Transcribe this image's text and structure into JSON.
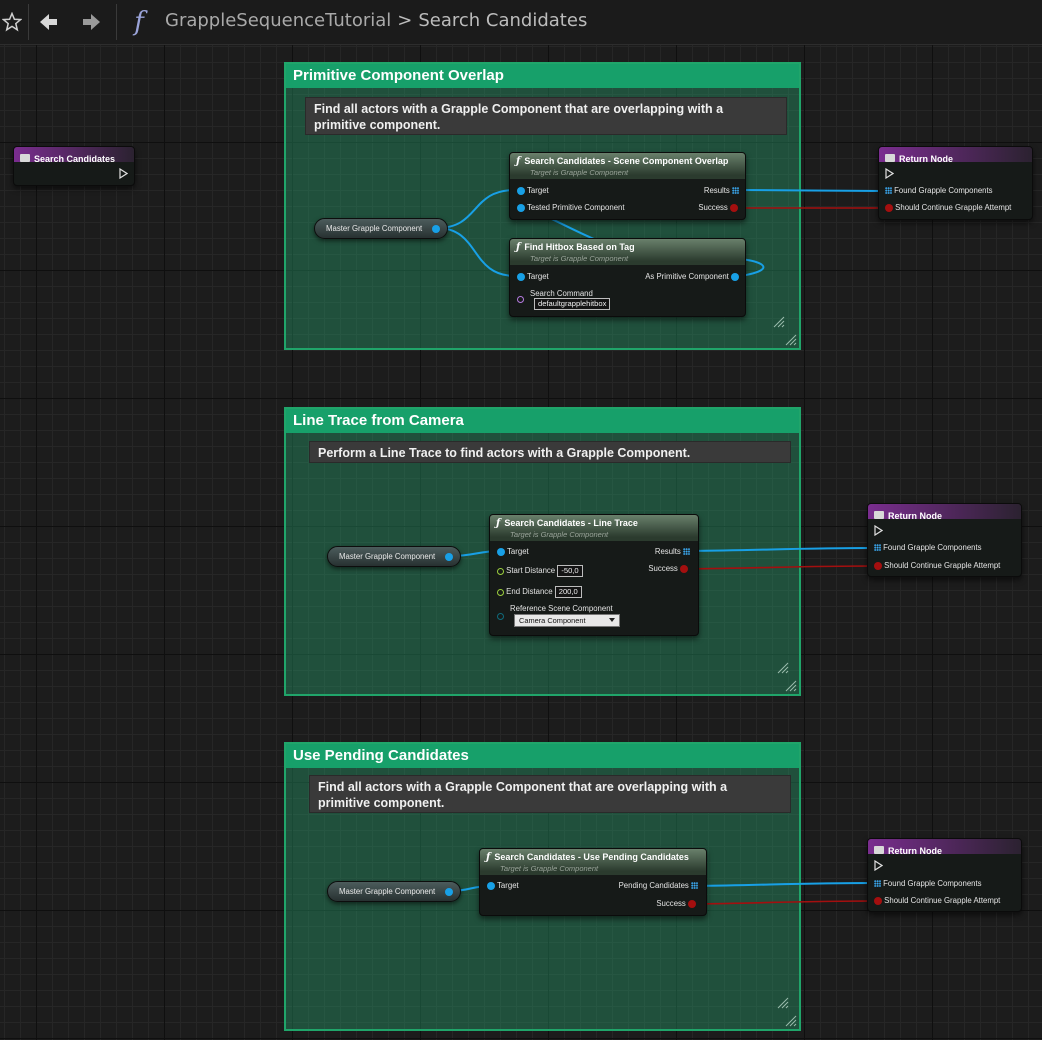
{
  "toolbar": {
    "breadcrumb_root": "GrappleSequenceTutorial",
    "breadcrumb_separator": ">",
    "breadcrumb_current": "Search Candidates",
    "function_icon_label": "f"
  },
  "entry_node": {
    "title": "Search Candidates"
  },
  "sections": [
    {
      "title": "Primitive Component Overlap",
      "description": "Find all actors with a Grapple Component that are overlapping with a primitive component.",
      "variable": "Master Grapple Component",
      "nodes": [
        {
          "title": "Search Candidates - Scene Component Overlap",
          "subtitle": "Target is Grapple Component",
          "inputs": [
            "Target",
            "Tested Primitive Component"
          ],
          "outputs": [
            "Results",
            "Success"
          ]
        },
        {
          "title": "Find Hitbox Based on Tag",
          "subtitle": "Target is Grapple Component",
          "inputs": [
            "Target",
            "Search Command"
          ],
          "search_command_value": "defaultgrapplehitbox",
          "outputs": [
            "As Primitive Component"
          ]
        }
      ],
      "return": {
        "title": "Return Node",
        "pins": [
          "Found Grapple Components",
          "Should Continue Grapple Attempt"
        ]
      }
    },
    {
      "title": "Line Trace from Camera",
      "description": "Perform a Line Trace to find actors with a Grapple Component.",
      "variable": "Master Grapple Component",
      "nodes": [
        {
          "title": "Search Candidates - Line Trace",
          "subtitle": "Target is Grapple Component",
          "inputs": [
            "Target",
            "Start Distance",
            "End Distance",
            "Reference Scene Component"
          ],
          "start_distance": "-50,0",
          "end_distance": "200,0",
          "reference_scene_component": "Camera Component",
          "outputs": [
            "Results",
            "Success"
          ]
        }
      ],
      "return": {
        "title": "Return Node",
        "pins": [
          "Found Grapple Components",
          "Should Continue Grapple Attempt"
        ]
      }
    },
    {
      "title": "Use Pending Candidates",
      "description": "Find all actors with a Grapple Component that are overlapping with a primitive component.",
      "variable": "Master Grapple Component",
      "nodes": [
        {
          "title": "Search Candidates - Use Pending Candidates",
          "subtitle": "Target is Grapple Component",
          "inputs": [
            "Target"
          ],
          "outputs": [
            "Pending Candidates",
            "Success"
          ]
        }
      ],
      "return": {
        "title": "Return Node",
        "pins": [
          "Found Grapple Components",
          "Should Continue Grapple Attempt"
        ]
      }
    }
  ],
  "colors": {
    "comment_title": "#17a06a",
    "object_pin": "#18a0e6",
    "bool_pin": "#a40f0f",
    "float_pin": "#9ccf3e",
    "name_pin": "#b57ae0",
    "return_node_header": "#7a2d8f"
  }
}
